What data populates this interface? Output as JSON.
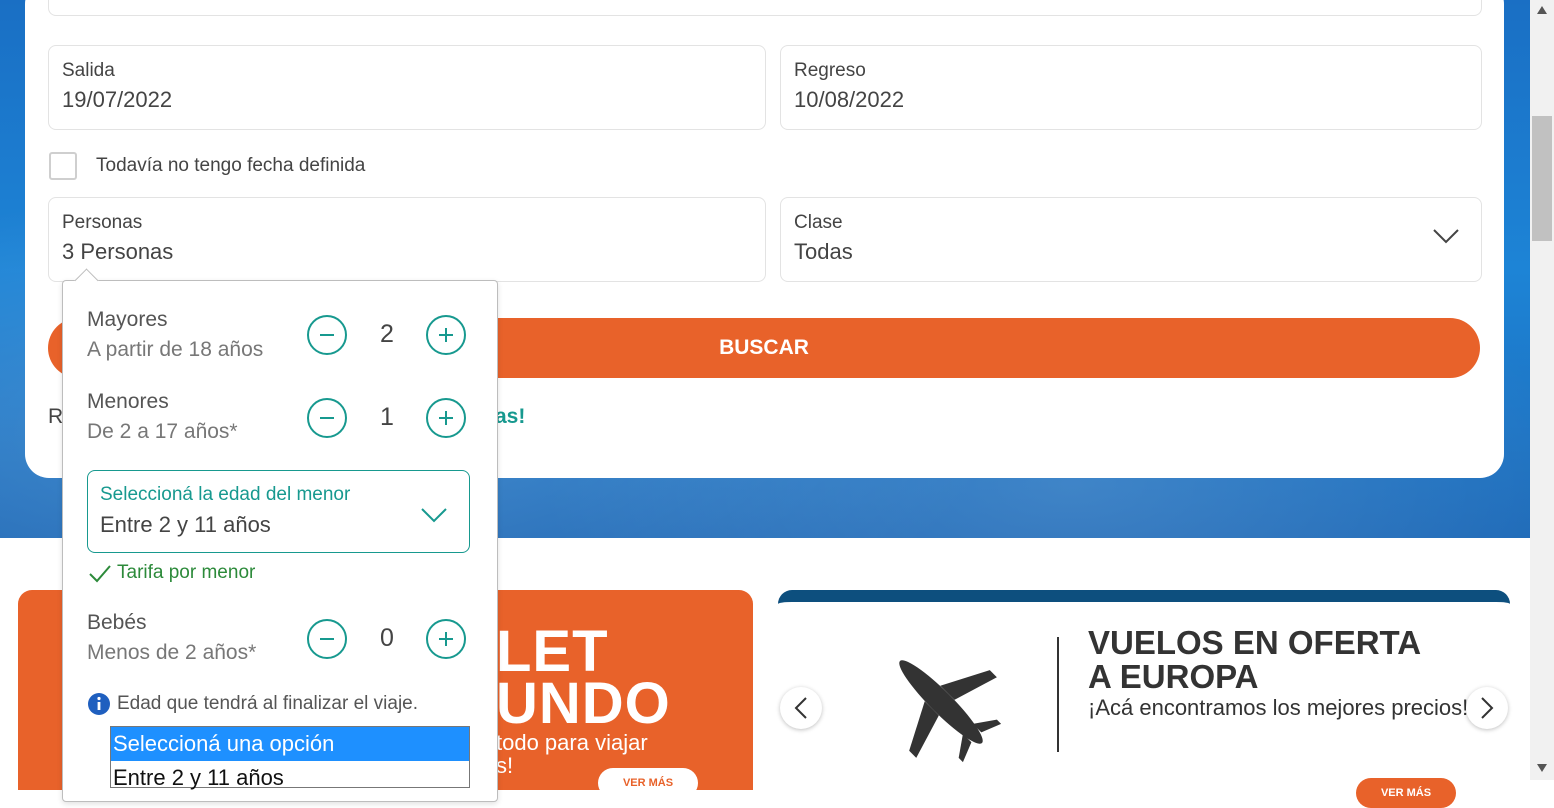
{
  "form": {
    "salida": {
      "label": "Salida",
      "value": "19/07/2022"
    },
    "regreso": {
      "label": "Regreso",
      "value": "10/08/2022"
    },
    "no_date_label": "Todavía no tengo fecha definida",
    "personas": {
      "label": "Personas",
      "value": "3 Personas"
    },
    "clase": {
      "label": "Clase",
      "value": "Todas"
    },
    "buscar_label": "BUSCAR",
    "promo_prefix": "R",
    "promo_link": "as!"
  },
  "passengers": {
    "mayores": {
      "title": "Mayores",
      "sub": "A partir de 18 años",
      "count": "2"
    },
    "menores": {
      "title": "Menores",
      "sub": "De 2 a 17 años*",
      "count": "1"
    },
    "age_select": {
      "label": "Seleccioná la edad del menor",
      "value": "Entre 2 y 11 años"
    },
    "tarifa": "Tarifa por menor",
    "bebes": {
      "title": "Bebés",
      "sub": "Menos de 2 años*",
      "count": "0"
    },
    "info": "Edad que tendrá al finalizar el viaje.",
    "options": [
      "Seleccioná una opción",
      "Entre 2 y 11 años"
    ]
  },
  "banners": {
    "b1_line1": "LET",
    "b1_line2": "UNDO",
    "b1_small1": "todo para viajar",
    "b1_small2": "s!",
    "b1_btn": "VER MÁS",
    "b2_title1": "VUELOS EN OFERTA",
    "b2_title2": "A EUROPA",
    "b2_sub": "¡Acá encontramos los mejores precios!",
    "b2_btn": "VER MÁS"
  },
  "colors": {
    "accent": "#e8622a",
    "teal": "#17998f",
    "navy": "#0d4f7e"
  }
}
